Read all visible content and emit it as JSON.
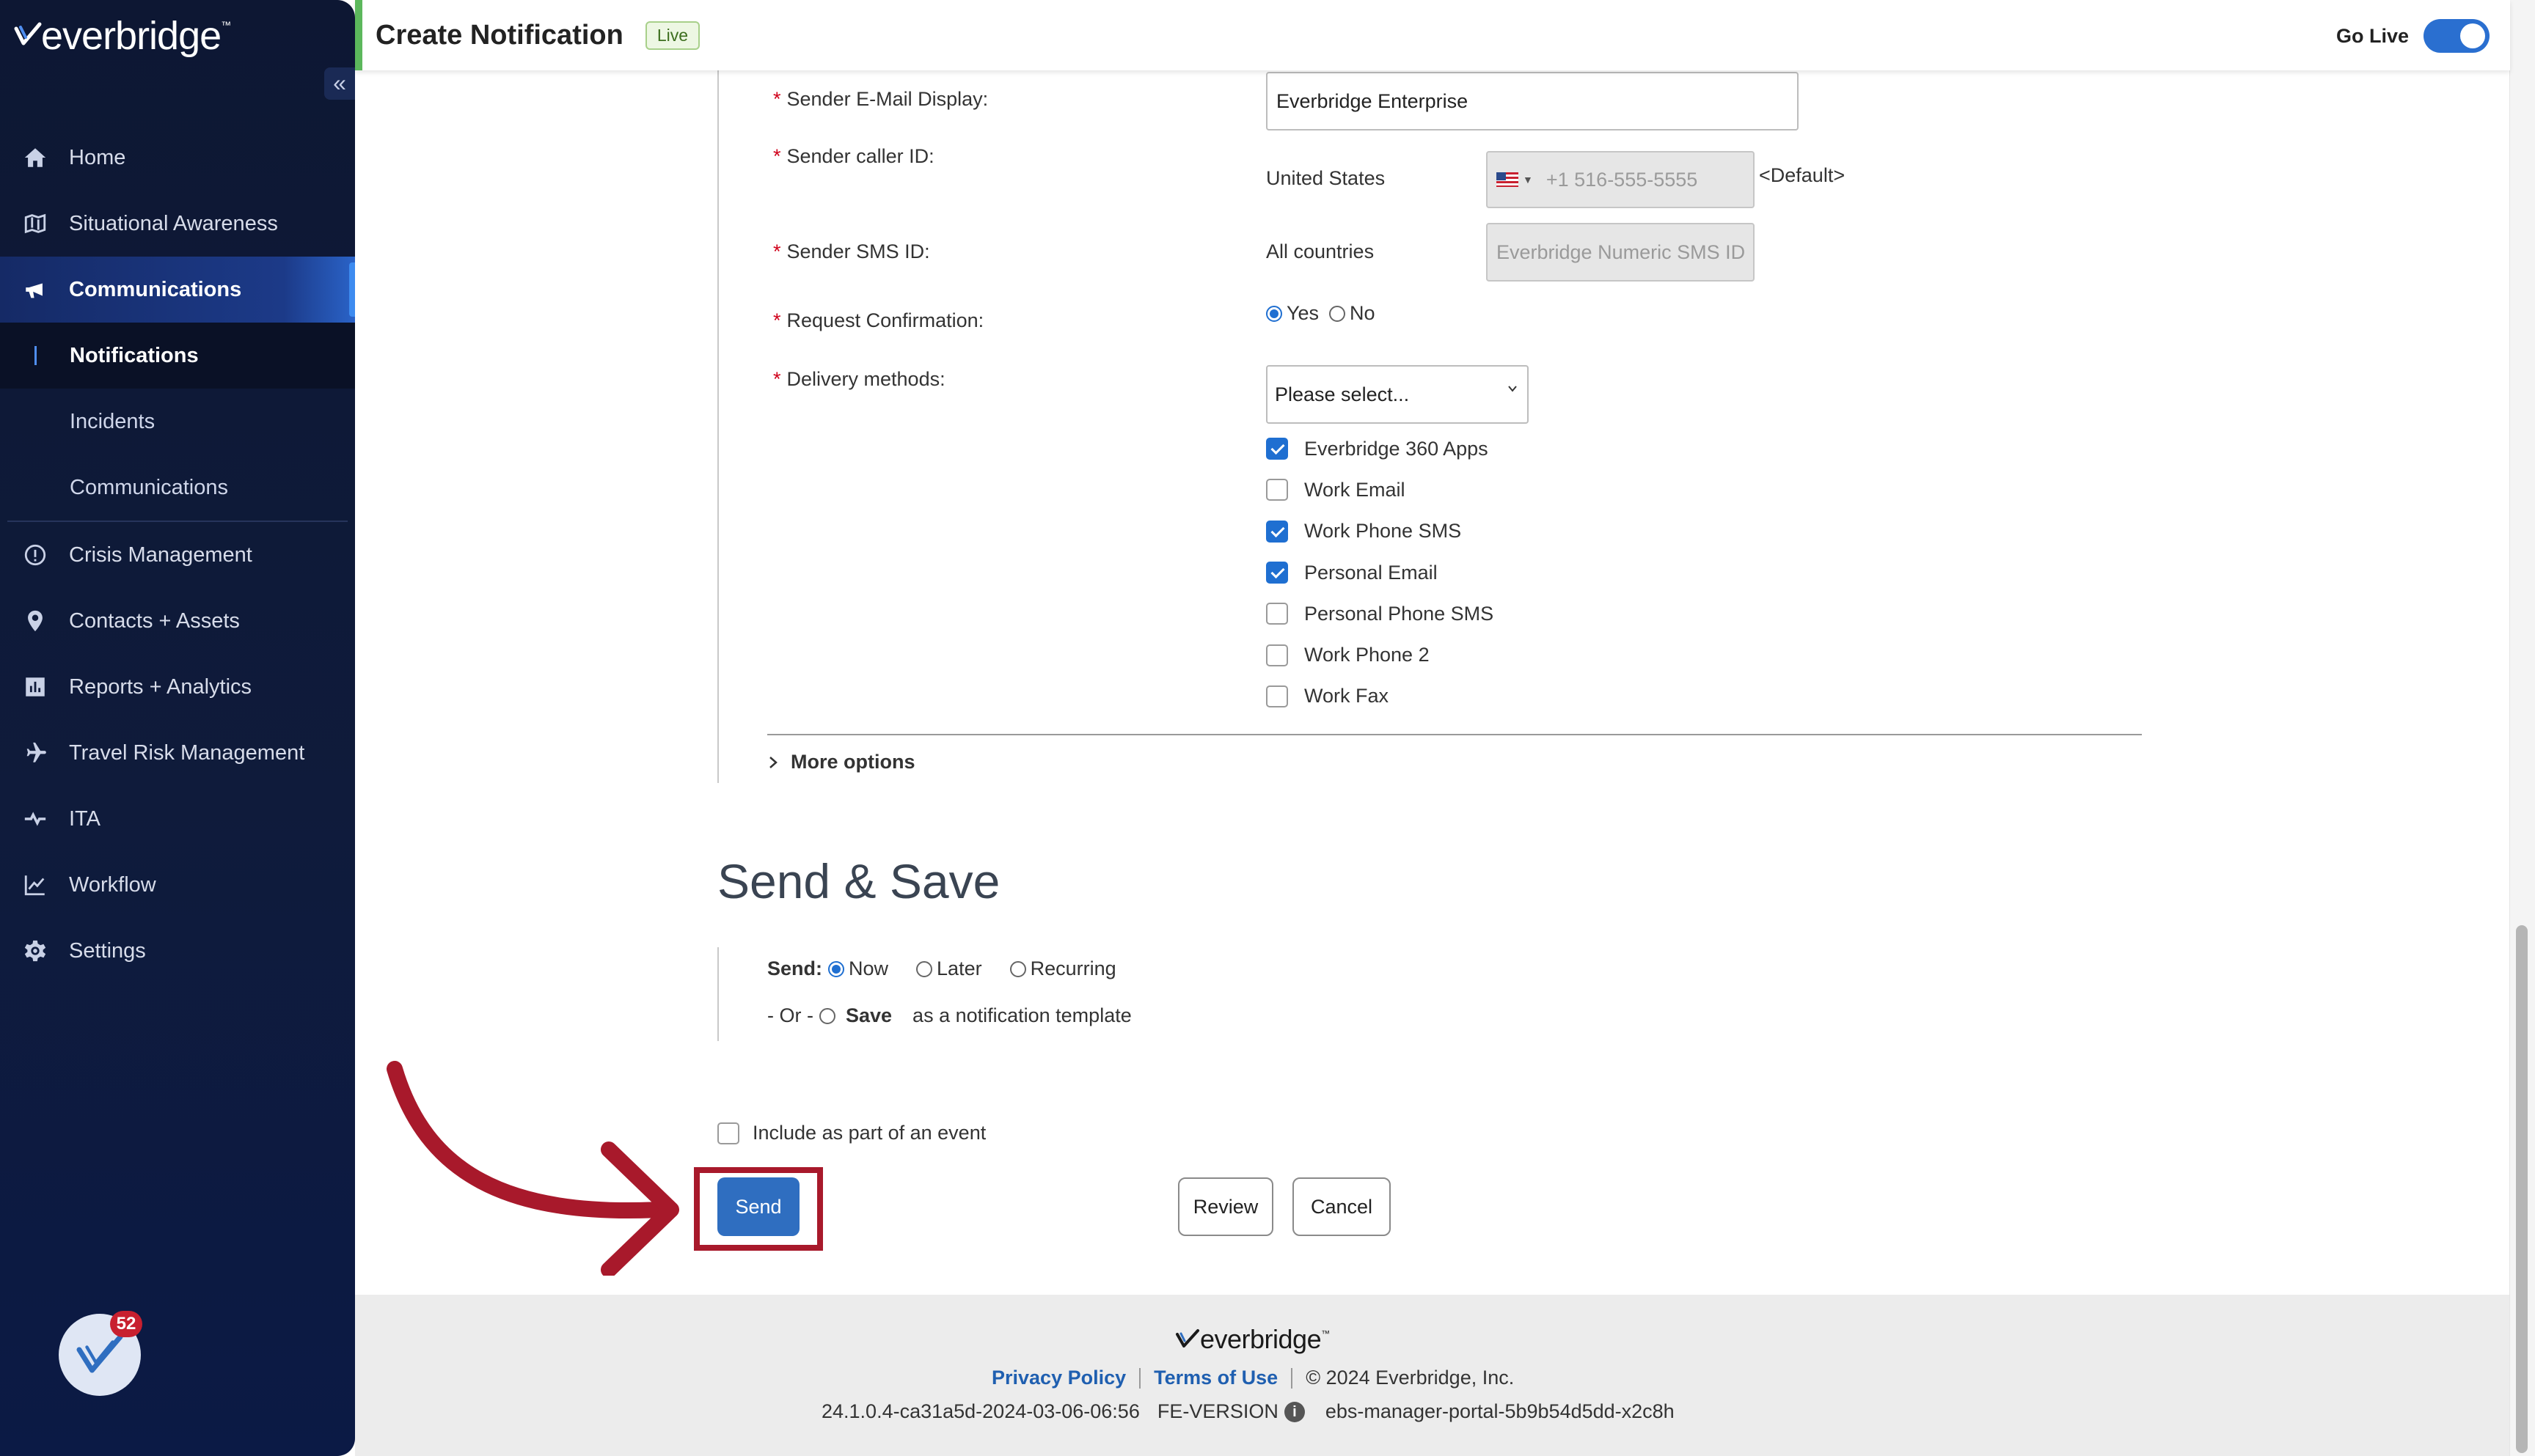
{
  "sidebar": {
    "logo_text": "everbridge",
    "collapse_glyph": "«",
    "nav": [
      {
        "label": "Home",
        "icon": "home-icon"
      },
      {
        "label": "Situational Awareness",
        "icon": "map-icon"
      },
      {
        "label": "Communications",
        "icon": "megaphone-icon",
        "active": true
      },
      {
        "label": "Notifications",
        "sub": true,
        "current": true
      },
      {
        "label": "Incidents",
        "sub": true
      },
      {
        "label": "Communications",
        "sub": true
      },
      {
        "label": "Crisis Management",
        "icon": "alert-circle-icon"
      },
      {
        "label": "Contacts + Assets",
        "icon": "location-pin-icon"
      },
      {
        "label": "Reports + Analytics",
        "icon": "bar-chart-icon"
      },
      {
        "label": "Travel Risk Management",
        "icon": "airplane-icon"
      },
      {
        "label": "ITA",
        "icon": "ita-icon"
      },
      {
        "label": "Workflow",
        "icon": "line-chart-icon"
      },
      {
        "label": "Settings",
        "icon": "gear-icon"
      }
    ],
    "badge_count": "52"
  },
  "header": {
    "title": "Create Notification",
    "status_pill": "Live",
    "go_live_label": "Go Live",
    "go_live_on": true
  },
  "form": {
    "sender_email_label": "Sender E-Mail Display:",
    "sender_email_value": "Everbridge Enterprise",
    "caller_id_label": "Sender caller ID:",
    "caller_id_country": "United States",
    "caller_id_placeholder": "+1 516-555-5555",
    "caller_id_default": "<Default>",
    "sms_id_label": "Sender SMS ID:",
    "sms_id_country": "All countries",
    "sms_id_placeholder": "Everbridge Numeric SMS ID",
    "confirm_label": "Request Confirmation:",
    "confirm_yes": "Yes",
    "confirm_no": "No",
    "confirm_selected": "Yes",
    "delivery_label": "Delivery methods:",
    "delivery_select": "Please select...",
    "delivery_methods": [
      {
        "label": "Everbridge 360 Apps",
        "checked": true
      },
      {
        "label": "Work Email",
        "checked": false
      },
      {
        "label": "Work Phone SMS",
        "checked": true
      },
      {
        "label": "Personal Email",
        "checked": true
      },
      {
        "label": "Personal Phone SMS",
        "checked": false
      },
      {
        "label": "Work Phone 2",
        "checked": false
      },
      {
        "label": "Work Fax",
        "checked": false
      }
    ],
    "more_options": "More options"
  },
  "send_save": {
    "title": "Send & Save",
    "send_label": "Send:",
    "send_options": [
      "Now",
      "Later",
      "Recurring"
    ],
    "send_selected": "Now",
    "or_text": "- Or -",
    "save_label": "Save",
    "save_suffix": "as a notification template",
    "include_event": "Include as part of an event",
    "buttons": {
      "send": "Send",
      "review": "Review",
      "cancel": "Cancel"
    }
  },
  "footer": {
    "logo_text": "everbridge",
    "privacy": "Privacy Policy",
    "terms": "Terms of Use",
    "copyright": "© 2024 Everbridge, Inc.",
    "version": "24.1.0.4-ca31a5d-2024-03-06-06:56",
    "fe_version": "FE-VERSION",
    "portal": "ebs-manager-portal-5b9b54d5dd-x2c8h"
  },
  "colors": {
    "sidebar_bg": "#0f1b3b",
    "accent_blue": "#2f6ec0",
    "highlight_red": "#a8192b",
    "live_green": "#5cb85c"
  }
}
